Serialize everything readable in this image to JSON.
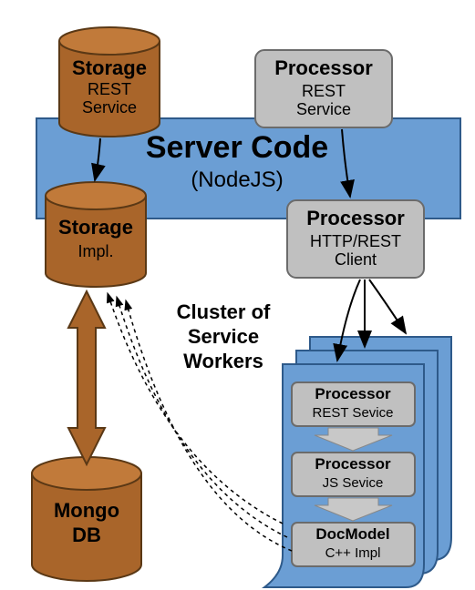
{
  "serverCode": {
    "title": "Server Code",
    "subtitle": "(NodeJS)"
  },
  "storageRest": {
    "title": "Storage",
    "line1": "REST",
    "line2": "Service"
  },
  "storageImpl": {
    "title": "Storage",
    "line1": "Impl."
  },
  "processorRest": {
    "title": "Processor",
    "line1": "REST",
    "line2": "Service"
  },
  "processorClient": {
    "title": "Processor",
    "line1": "HTTP/REST",
    "line2": "Client"
  },
  "clusterLabel": {
    "line1": "Cluster of",
    "line2": "Service",
    "line3": "Workers"
  },
  "worker": {
    "procRest": {
      "title": "Processor",
      "sub": "REST Sevice"
    },
    "procJs": {
      "title": "Processor",
      "sub": "JS Sevice"
    },
    "docModel": {
      "title": "DocModel",
      "sub": "C++ Impl"
    }
  },
  "mongo": {
    "line1": "Mongo",
    "line2": "DB"
  },
  "colors": {
    "blue": "#6b9ed4",
    "blueDark": "#2e5a8a",
    "brown": "#a9652a",
    "brownLight": "#c17a3a",
    "brownDark": "#7a4a1f",
    "grey": "#c0c0c0",
    "greyBorder": "#6b6b6b"
  }
}
